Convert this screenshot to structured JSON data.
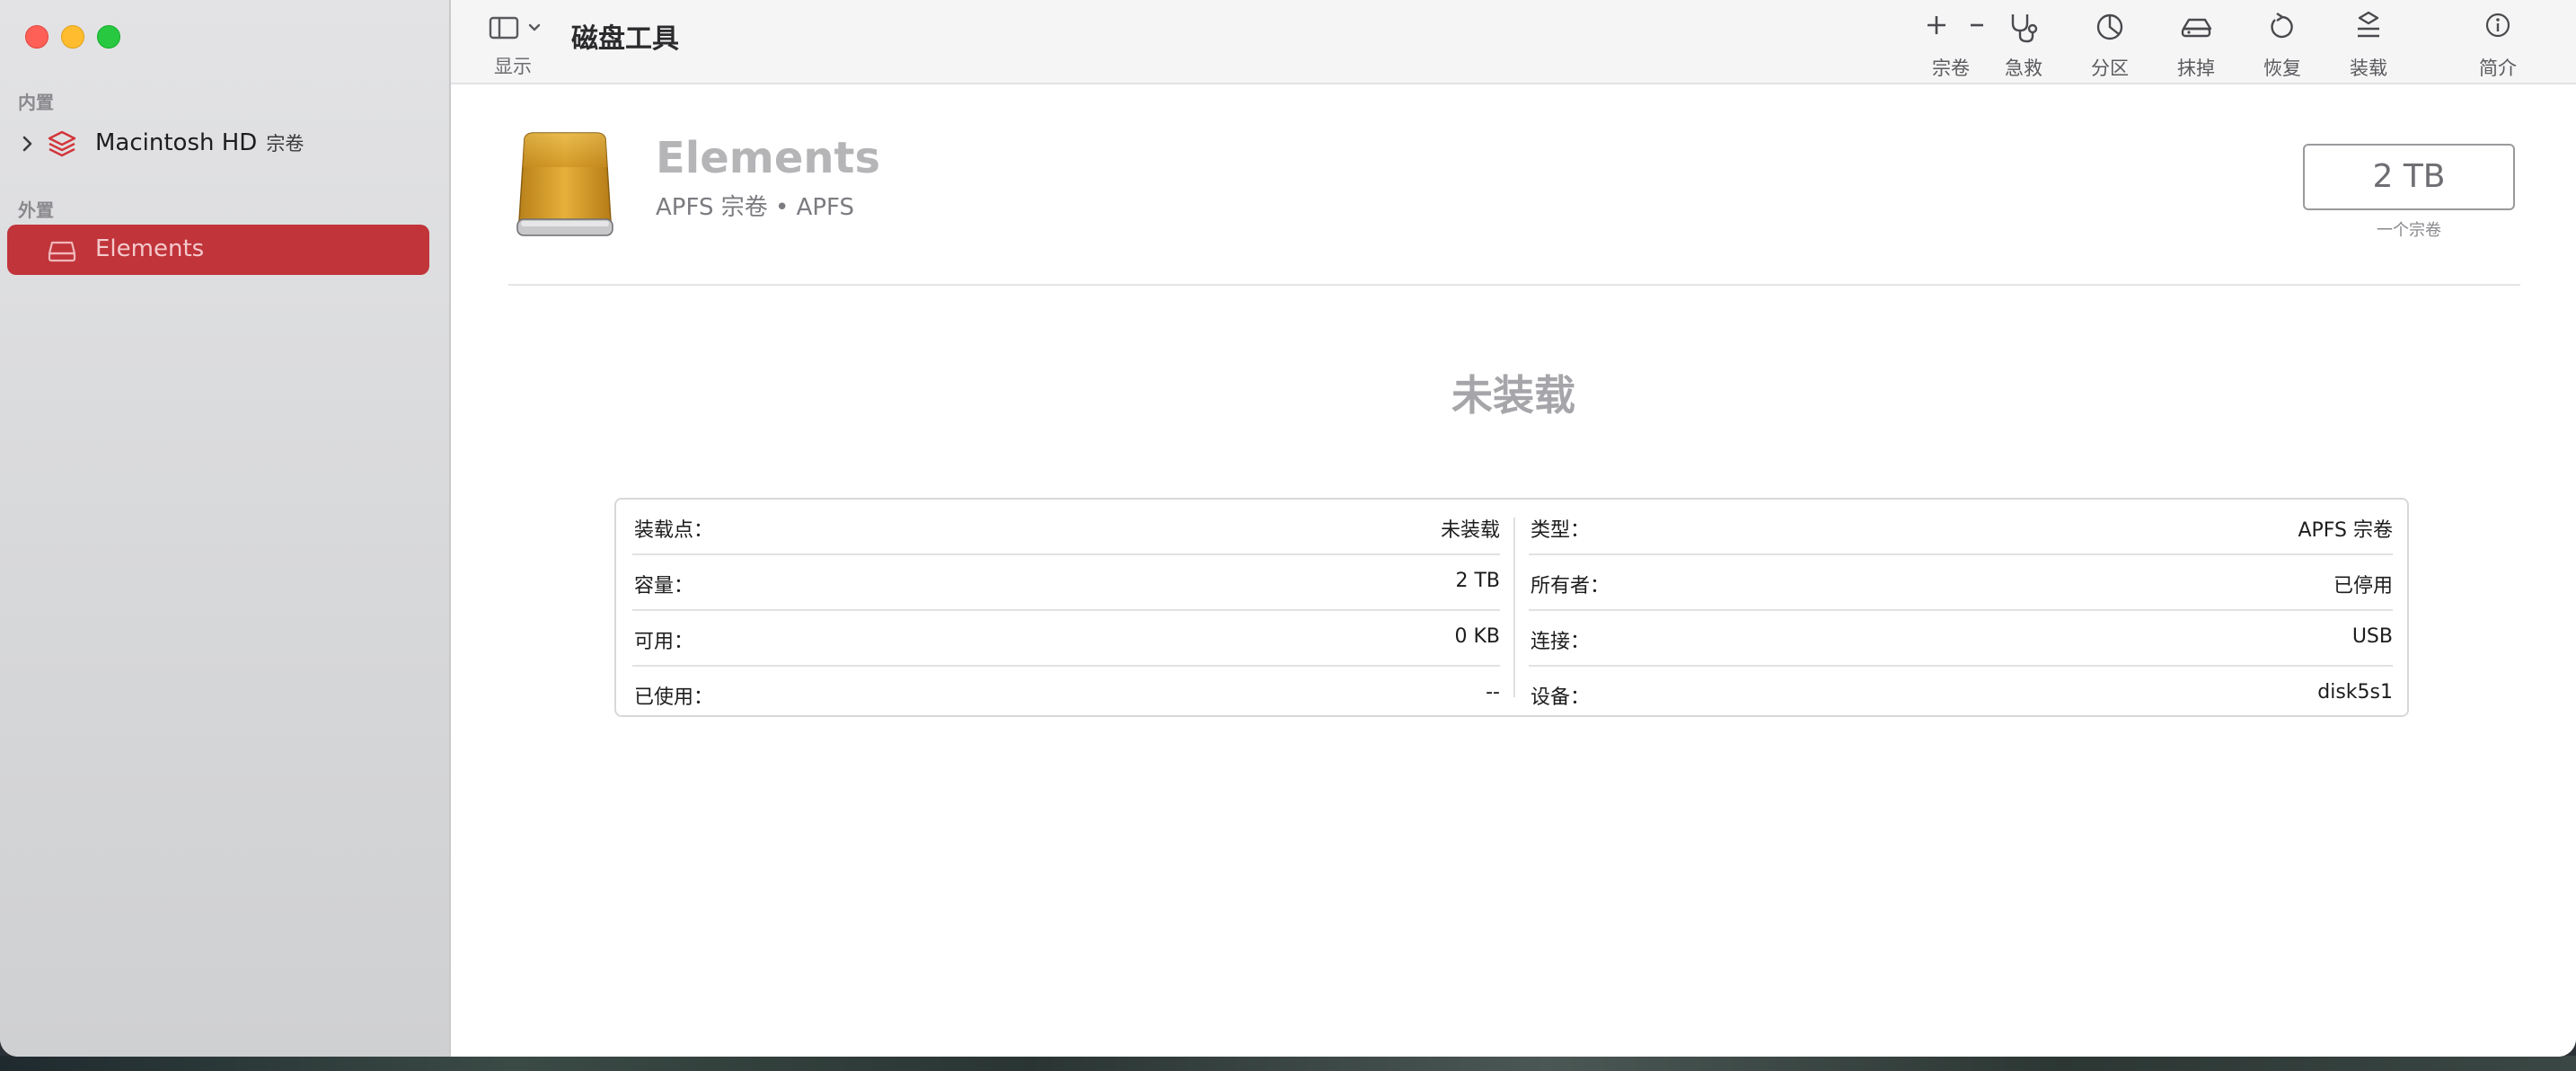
{
  "window": {
    "app_title": "磁盘工具"
  },
  "sidebar": {
    "sections": [
      {
        "label": "内置",
        "items": [
          {
            "name": "Macintosh HD",
            "tag": "宗卷"
          }
        ]
      },
      {
        "label": "外置",
        "items": [
          {
            "name": "Elements"
          }
        ]
      }
    ]
  },
  "toolbar": {
    "view_label": "显示",
    "buttons": [
      {
        "label": "宗卷",
        "icon": "plus-minus-icon"
      },
      {
        "label": "急救",
        "icon": "stethoscope-icon"
      },
      {
        "label": "分区",
        "icon": "pie-chart-icon"
      },
      {
        "label": "抹掉",
        "icon": "eraser-icon"
      },
      {
        "label": "恢复",
        "icon": "restore-icon"
      },
      {
        "label": "装载",
        "icon": "mount-icon"
      },
      {
        "label": "简介",
        "icon": "info-icon"
      }
    ]
  },
  "disk": {
    "name": "Elements",
    "subtitle": "APFS 宗卷 • APFS",
    "size": "2 TB",
    "size_caption": "一个宗卷",
    "status": "未装载"
  },
  "info_table": {
    "left": [
      {
        "key": "装载点：",
        "value": "未装载"
      },
      {
        "key": "容量：",
        "value": "2 TB"
      },
      {
        "key": "可用：",
        "value": "0 KB"
      },
      {
        "key": "已使用：",
        "value": "--"
      }
    ],
    "right": [
      {
        "key": "类型：",
        "value": "APFS 宗卷"
      },
      {
        "key": "所有者：",
        "value": "已停用"
      },
      {
        "key": "连接：",
        "value": "USB"
      },
      {
        "key": "设备：",
        "value": "disk5s1"
      }
    ]
  },
  "colors": {
    "selection": "#c0343a",
    "disk_gold": "#d9a22b",
    "close": "#fe5f57",
    "minimize": "#febc2e",
    "zoom": "#28c840"
  }
}
